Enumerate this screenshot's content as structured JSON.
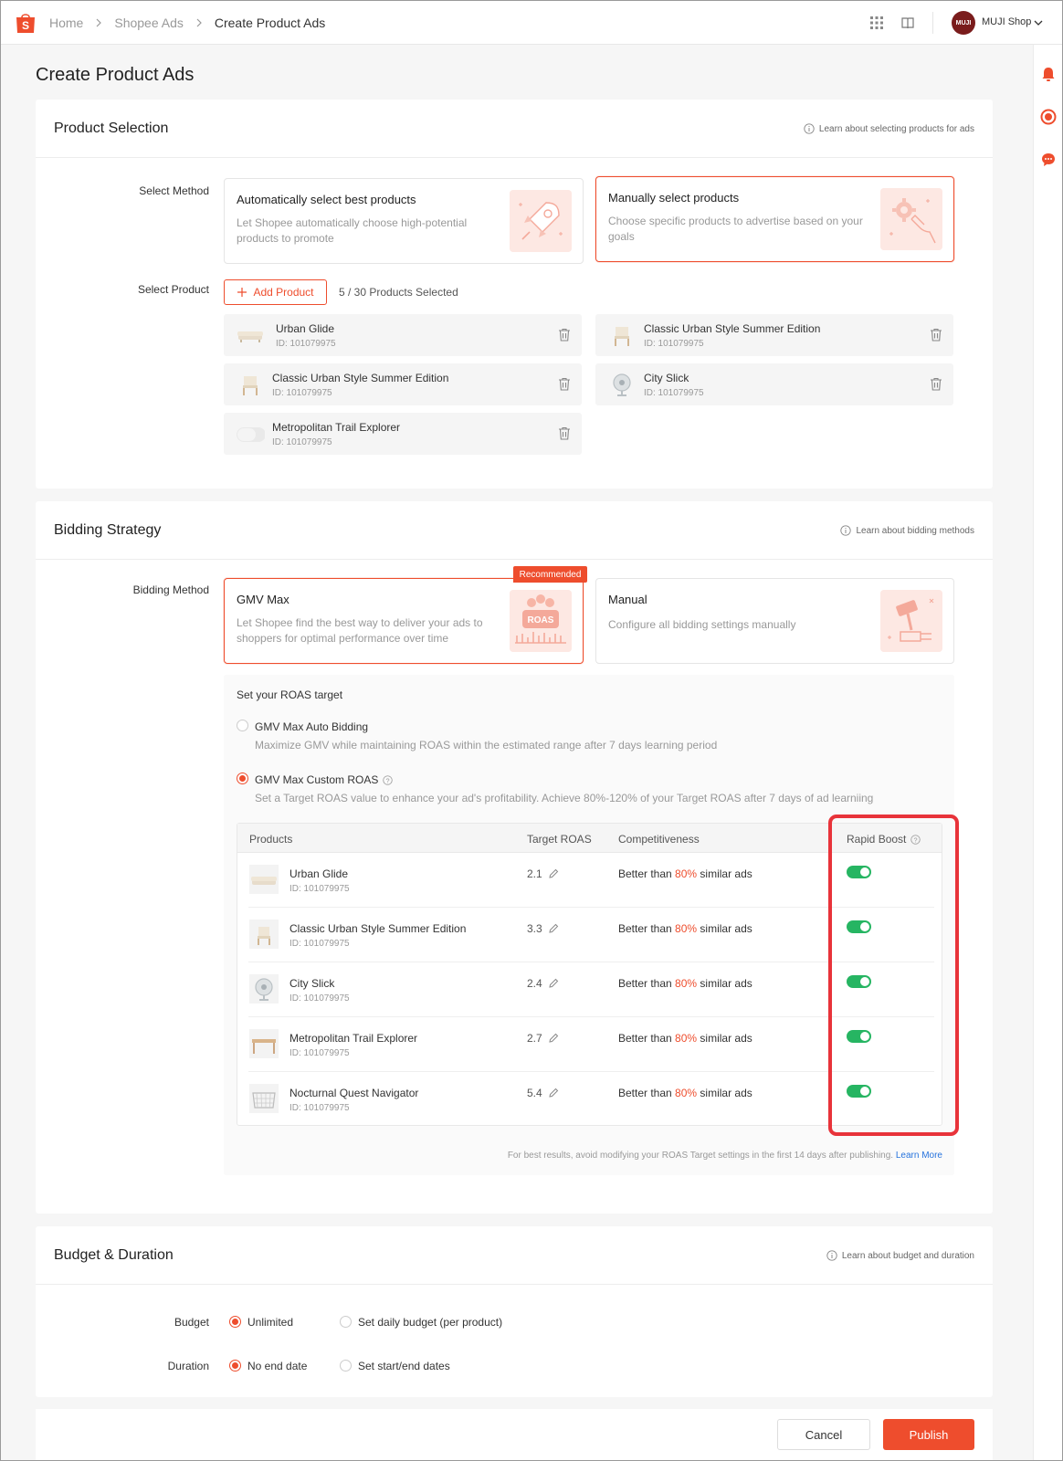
{
  "breadcrumbs": [
    "Home",
    "Shopee Ads",
    "Create Product Ads"
  ],
  "shop": {
    "name": "MUJI Shop",
    "avatar_text": "MUJI"
  },
  "page_title": "Create Product Ads",
  "colors": {
    "accent": "#ee4d2d",
    "toggle_on": "#26b562",
    "highlight": "#e8333a",
    "link": "#2673dd"
  },
  "product_selection": {
    "title": "Product Selection",
    "learn": "Learn about selecting products for ads",
    "select_method_label": "Select Method",
    "methods": [
      {
        "title": "Automatically select best products",
        "desc": "Let Shopee automatically choose high-potential products to promote",
        "selected": false,
        "icon": "rocket-icon"
      },
      {
        "title": "Manually select products",
        "desc": "Choose specific products to advertise based on your goals",
        "selected": true,
        "icon": "gear-hand-icon"
      }
    ],
    "select_product_label": "Select Product",
    "add_button": "Add Product",
    "selected_count": "5 / 30 Products Selected",
    "products": [
      {
        "name": "Urban Glide",
        "id": "ID: 101079975",
        "thumb": "sofa"
      },
      {
        "name": "Classic Urban Style Summer Edition",
        "id": "ID: 101079975",
        "thumb": "chair"
      },
      {
        "name": "Classic Urban Style Summer Edition",
        "id": "ID: 101079975",
        "thumb": "chair"
      },
      {
        "name": "City Slick",
        "id": "ID: 101079975",
        "thumb": "fan"
      },
      {
        "name": "Metropolitan Trail Explorer",
        "id": "ID: 101079975",
        "thumb": "speaker"
      }
    ]
  },
  "bidding": {
    "title": "Bidding Strategy",
    "learn": "Learn about bidding methods",
    "method_label": "Bidding Method",
    "recommended": "Recommended",
    "methods": [
      {
        "title": "GMV Max",
        "desc": "Let Shopee find the best way to deliver your ads to shoppers for optimal performance over time",
        "selected": true,
        "icon": "roas-icon",
        "art_text": "ROAS"
      },
      {
        "title": "Manual",
        "desc": "Configure all bidding settings manually",
        "selected": false,
        "icon": "gavel-icon"
      }
    ],
    "roas_heading": "Set your ROAS target",
    "options": [
      {
        "title": "GMV Max Auto Bidding",
        "desc": "Maximize GMV while maintaining ROAS within the estimated range after 7 days learning period",
        "selected": false
      },
      {
        "title": "GMV Max Custom ROAS",
        "desc": "Set a Target ROAS value to enhance your ad's profitability. Achieve 80%-120% of your Target ROAS after 7 days of ad learniing",
        "selected": true
      }
    ],
    "table": {
      "headers": [
        "Products",
        "Target ROAS",
        "Competitiveness",
        "Rapid Boost"
      ],
      "comp_prefix": "Better than ",
      "comp_suffix": " similar ads",
      "rows": [
        {
          "name": "Urban Glide",
          "id": "ID: 101079975",
          "roas": "2.1",
          "comp": "80%",
          "boost": true,
          "thumb": "sofa"
        },
        {
          "name": "Classic Urban Style Summer Edition",
          "id": "ID: 101079975",
          "roas": "3.3",
          "comp": "80%",
          "boost": true,
          "thumb": "chair"
        },
        {
          "name": "City Slick",
          "id": "ID: 101079975",
          "roas": "2.4",
          "comp": "80%",
          "boost": true,
          "thumb": "fan"
        },
        {
          "name": "Metropolitan Trail Explorer",
          "id": "ID: 101079975",
          "roas": "2.7",
          "comp": "80%",
          "boost": true,
          "thumb": "table"
        },
        {
          "name": "Nocturnal Quest Navigator",
          "id": "ID: 101079975",
          "roas": "5.4",
          "comp": "80%",
          "boost": true,
          "thumb": "basket"
        }
      ]
    },
    "footnote": "For best results, avoid modifying your ROAS Target settings in the first 14 days after publishing.",
    "footnote_link": "Learn More"
  },
  "budget": {
    "title": "Budget & Duration",
    "learn": "Learn about budget and duration",
    "budget_label": "Budget",
    "budget_options": [
      {
        "label": "Unlimited",
        "selected": true
      },
      {
        "label": "Set daily budget (per product)",
        "selected": false
      }
    ],
    "duration_label": "Duration",
    "duration_options": [
      {
        "label": "No end date",
        "selected": true
      },
      {
        "label": "Set start/end dates",
        "selected": false
      }
    ]
  },
  "actions": {
    "cancel": "Cancel",
    "publish": "Publish"
  }
}
